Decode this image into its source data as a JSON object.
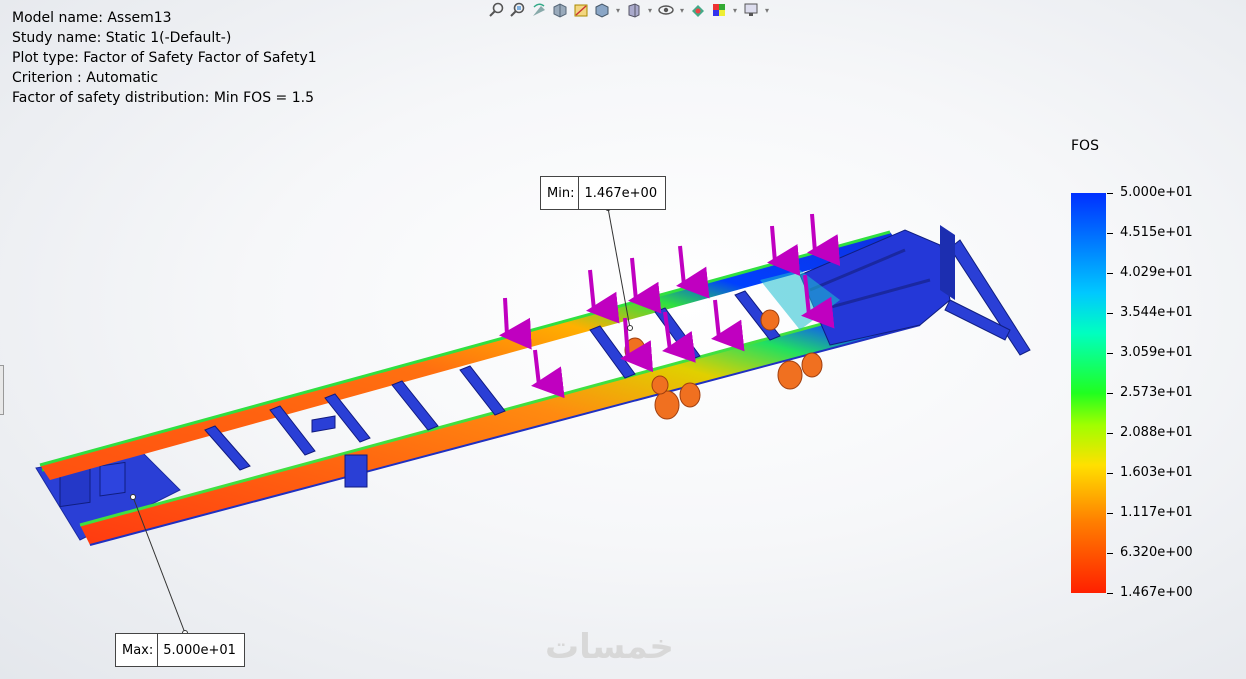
{
  "study_info": {
    "model_name": "Model name: Assem13",
    "study_name": "Study name: Static 1(-Default-)",
    "plot_type": "Plot type: Factor of Safety Factor of Safety1",
    "criterion": "Criterion : Automatic",
    "distribution": "Factor of safety distribution: Min FOS = 1.5"
  },
  "toolbar": {
    "icons": [
      "zoom-to-fit-icon",
      "zoom-area-icon",
      "previous-view-icon",
      "section-view-icon",
      "view-dynamic-annotation-icon",
      "display-style-icon",
      "view-orientation-icon",
      "hide-show-icon",
      "edit-appearance-icon",
      "apply-scene-icon",
      "view-settings-icon"
    ]
  },
  "legend": {
    "title": "FOS",
    "labels": [
      "5.000e+01",
      "4.515e+01",
      "4.029e+01",
      "3.544e+01",
      "3.059e+01",
      "2.573e+01",
      "2.088e+01",
      "1.603e+01",
      "1.117e+01",
      "6.320e+00",
      "1.467e+00"
    ]
  },
  "callouts": {
    "min_label": "Min:",
    "min_value": "1.467e+00",
    "max_label": "Max:",
    "max_value": "5.000e+01"
  },
  "watermark": "خمسات",
  "colors": {
    "min_color": "#ff2000",
    "max_color": "#0030ff",
    "load_arrow": "#c000c0"
  }
}
